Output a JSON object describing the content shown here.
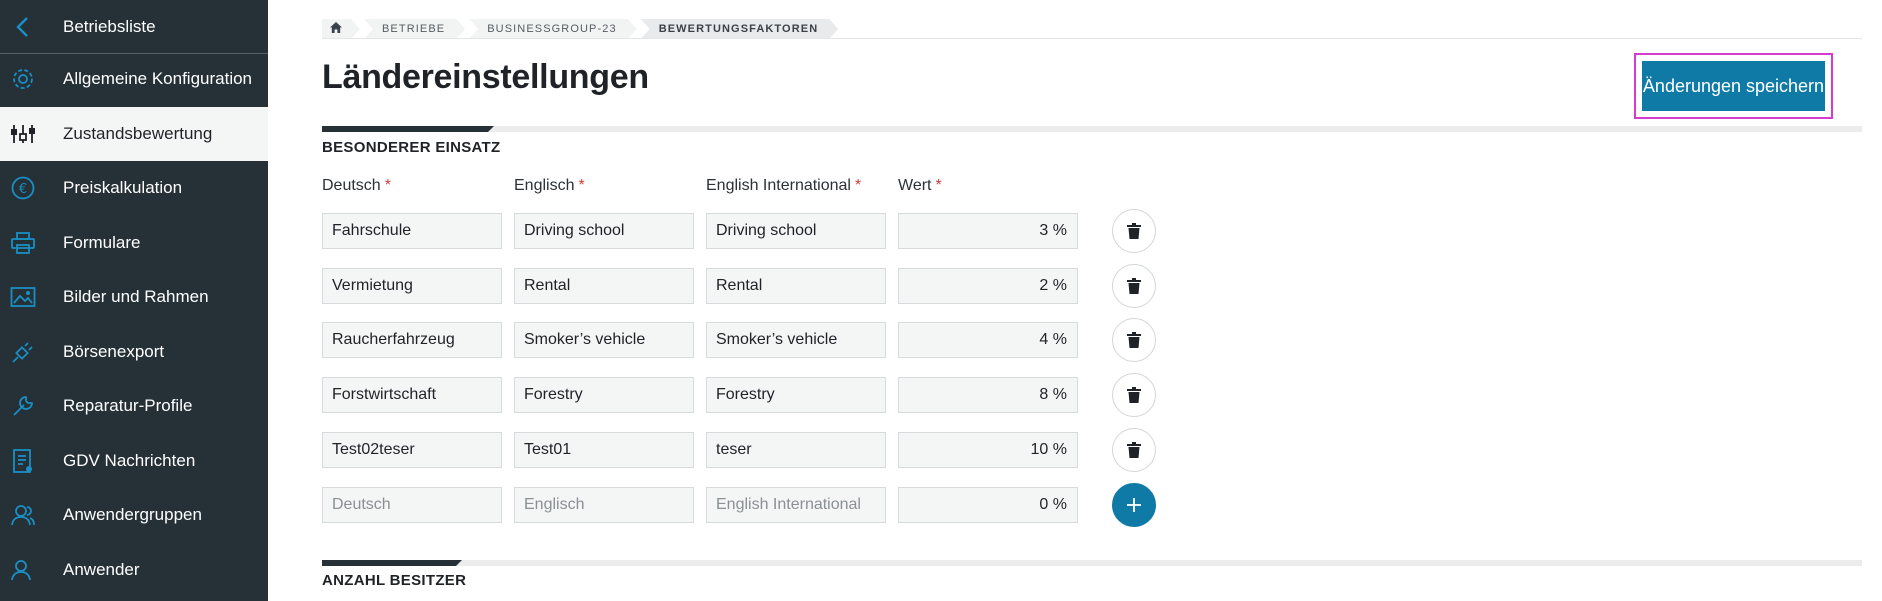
{
  "sidebar": {
    "items": [
      {
        "label": "Betriebsliste",
        "icon": "chevron-left-icon"
      },
      {
        "label": "Allgemeine Konfiguration",
        "icon": "gear-icon"
      },
      {
        "label": "Zustandsbewertung",
        "icon": "sliders-icon"
      },
      {
        "label": "Preiskalkulation",
        "icon": "euro-icon"
      },
      {
        "label": "Formulare",
        "icon": "printer-icon"
      },
      {
        "label": "Bilder und Rahmen",
        "icon": "image-icon"
      },
      {
        "label": "Börsenexport",
        "icon": "plug-icon"
      },
      {
        "label": "Reparatur-Profile",
        "icon": "wrench-icon"
      },
      {
        "label": "GDV Nachrichten",
        "icon": "document-icon"
      },
      {
        "label": "Anwendergruppen",
        "icon": "user-group-icon"
      },
      {
        "label": "Anwender",
        "icon": "user-icon"
      }
    ],
    "active_index": 2,
    "colors": {
      "background": "#253037",
      "accent": "#1a8fc4"
    }
  },
  "breadcrumb": [
    {
      "label": ""
    },
    {
      "label": "BETRIEBE"
    },
    {
      "label": "BUSINESSGROUP-23"
    },
    {
      "label": "BEWERTUNGSFAKTOREN"
    }
  ],
  "page_title": "Ländereinstellungen",
  "save_button": {
    "label": "Änderungen speichern",
    "color": "#0f7aa5"
  },
  "section_special": {
    "title": "BESONDERER EINSATZ",
    "columns": [
      {
        "label": "Deutsch",
        "required": "*"
      },
      {
        "label": "Englisch",
        "required": "*"
      },
      {
        "label": "English International",
        "required": "*"
      },
      {
        "label": "Wert",
        "required": "*"
      }
    ],
    "rows": [
      {
        "de": "Fahrschule",
        "en": "Driving school",
        "intl": "Driving school",
        "value": "3 %"
      },
      {
        "de": "Vermietung",
        "en": "Rental",
        "intl": "Rental",
        "value": "2 %"
      },
      {
        "de": "Raucherfahrzeug",
        "en": "Smoker’s vehicle",
        "intl": "Smoker’s vehicle",
        "value": "4 %"
      },
      {
        "de": "Forstwirtschaft",
        "en": "Forestry",
        "intl": "Forestry",
        "value": "8 %"
      },
      {
        "de": "Test02teser",
        "en": "Test01",
        "intl": "teser",
        "value": "10 %"
      }
    ],
    "new_row": {
      "de_placeholder": "Deutsch",
      "en_placeholder": "Englisch",
      "intl_placeholder": "English International",
      "value": "0 %"
    }
  },
  "section_owners": {
    "title": "ANZAHL BESITZER"
  }
}
